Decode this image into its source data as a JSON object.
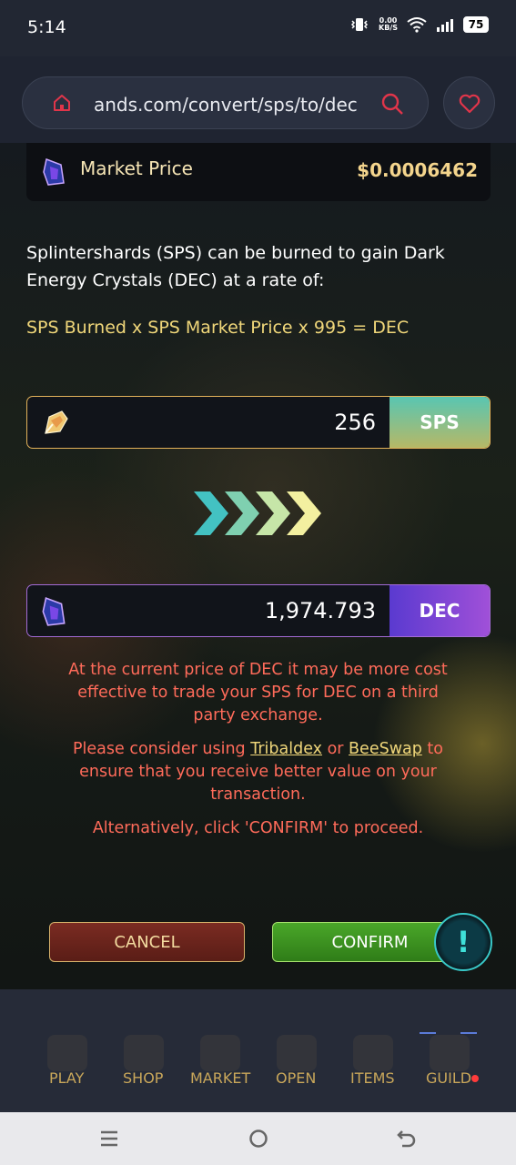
{
  "status_bar": {
    "time": "5:14",
    "net_speed_value": "0.00",
    "net_speed_unit": "KB/S",
    "battery": "75"
  },
  "browser": {
    "url": "ands.com/convert/sps/to/dec"
  },
  "market": {
    "label": "Market Price",
    "value": "$0.0006462"
  },
  "description": {
    "text": "Splintershards (SPS) can be burned to gain Dark Energy Crystals (DEC) at a rate of:",
    "formula": "SPS Burned x SPS Market Price x 995 = DEC"
  },
  "sps_field": {
    "value": "256",
    "unit": "SPS"
  },
  "dec_field": {
    "value": "1,974.793",
    "unit": "DEC"
  },
  "warning": {
    "line1": "At the current price of DEC it may be more cost effective to trade your SPS for DEC on a third party exchange.",
    "line2_prefix": "Please consider using ",
    "link1": "Tribaldex",
    "or": " or ",
    "link2": "BeeSwap",
    "line2_suffix": " to ensure that you receive better value on your transaction.",
    "line3": "Alternatively, click 'CONFIRM' to proceed."
  },
  "buttons": {
    "cancel": "CANCEL",
    "confirm": "CONFIRM",
    "alert": "!"
  },
  "nav": {
    "items": [
      "PLAY",
      "SHOP",
      "MARKET",
      "OPEN",
      "ITEMS",
      "GUILD"
    ]
  },
  "colors": {
    "accent_gold": "#f0d77a",
    "warning_red": "#ff6b5a",
    "confirm_green": "#3f9a22",
    "cancel_red": "#6b241c"
  }
}
